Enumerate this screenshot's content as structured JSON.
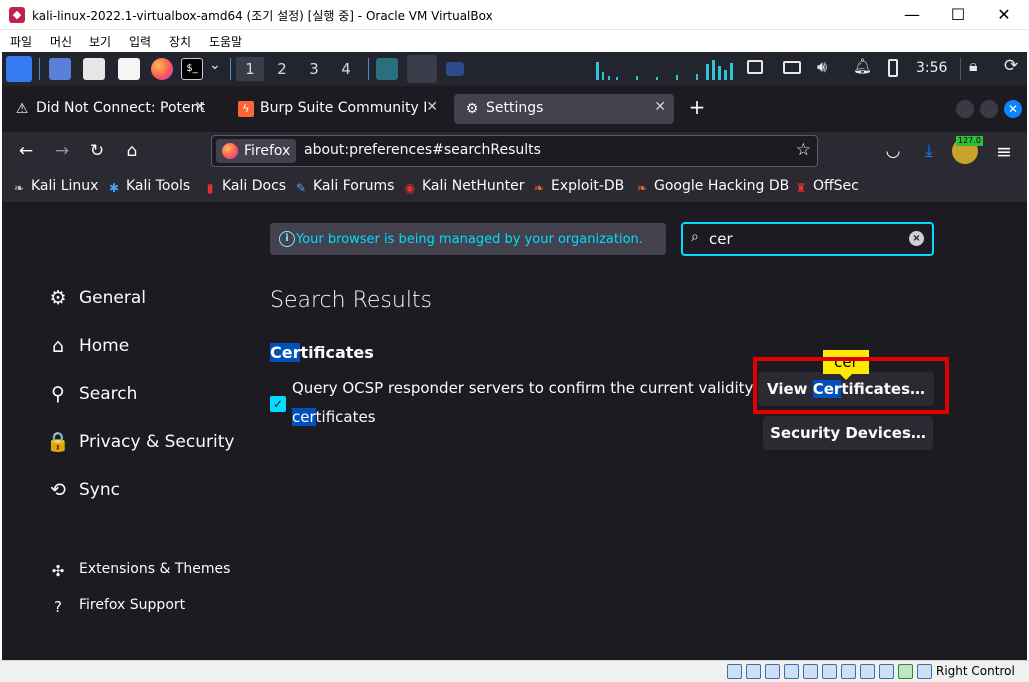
{
  "host_window": {
    "title": "kali-linux-2022.1-virtualbox-amd64 (조기 설정) [실행 중] - Oracle VM VirtualBox",
    "minimize_glyph": "—",
    "maximize_glyph": "☐",
    "close_glyph": "✕",
    "menu": [
      "파일",
      "머신",
      "보기",
      "입력",
      "장치",
      "도움말"
    ],
    "host_key_label": "Right Control"
  },
  "kali_panel": {
    "workspaces": [
      "1",
      "2",
      "3",
      "4"
    ],
    "active_workspace": "1",
    "clock": "3:56",
    "terminal_glyph": "$_",
    "chevron": "⌄"
  },
  "firefox": {
    "tabs": [
      {
        "label": "Did Not Connect: Potential Security Issue",
        "icon": "warning-icon",
        "glyph": "⚠",
        "close": "✕"
      },
      {
        "label": "Burp Suite Community Edition",
        "icon": "burp-icon",
        "glyph": "ϟ",
        "close": "✕"
      },
      {
        "label": "Settings",
        "icon": "gear-icon",
        "glyph": "⚙",
        "close": "✕"
      }
    ],
    "new_tab_glyph": "+",
    "close_window_glyph": "✕",
    "nav": {
      "back": "←",
      "forward": "→",
      "reload": "↻",
      "home": "⌂",
      "star": "☆",
      "pocket": "◡",
      "download": "⤓",
      "menu": "≡"
    },
    "url_chip": "Firefox",
    "url": "about:preferences#searchResults",
    "extension_badge": "127.0",
    "bookmarks": [
      {
        "label": "Kali Linux",
        "icon": "kali-dragon-icon",
        "glyph": "❧"
      },
      {
        "label": "Kali Tools",
        "icon": "kali-tools-icon",
        "glyph": "✱"
      },
      {
        "label": "Kali Docs",
        "icon": "kali-docs-icon",
        "glyph": "▮"
      },
      {
        "label": "Kali Forums",
        "icon": "kali-forums-icon",
        "glyph": "✎"
      },
      {
        "label": "Kali NetHunter",
        "icon": "nethunter-icon",
        "glyph": "◉"
      },
      {
        "label": "Exploit-DB",
        "icon": "exploitdb-icon",
        "glyph": "❧"
      },
      {
        "label": "Google Hacking DB",
        "icon": "ghdb-icon",
        "glyph": "❧"
      },
      {
        "label": "OffSec",
        "icon": "offsec-icon",
        "glyph": "♜"
      }
    ]
  },
  "prefs": {
    "policy_notice": "Your browser is being managed by your organization.",
    "info_glyph": "i",
    "search_glyph": "⌕",
    "clear_glyph": "×",
    "search_value": "cer",
    "categories": [
      {
        "label": "General",
        "icon": "gear-icon",
        "glyph": "⚙"
      },
      {
        "label": "Home",
        "icon": "home-icon",
        "glyph": "⌂"
      },
      {
        "label": "Search",
        "icon": "search-icon",
        "glyph": "⚲"
      },
      {
        "label": "Privacy & Security",
        "icon": "lock-icon",
        "glyph": "🔒"
      },
      {
        "label": "Sync",
        "icon": "sync-icon",
        "glyph": "⟲"
      }
    ],
    "footer_links": [
      {
        "label": "Extensions & Themes",
        "icon": "puzzle-icon",
        "glyph": "✣"
      },
      {
        "label": "Firefox Support",
        "icon": "help-icon",
        "glyph": "?"
      }
    ],
    "results_heading": "Search Results",
    "certs_heading_hl": "Cer",
    "certs_heading_rest": "tificates",
    "checkbox_glyph": "✓",
    "ocsp_line1": "Query OCSP responder servers to confirm the current validity of",
    "ocsp_line2_hl": "cer",
    "ocsp_line2_rest": "tificates",
    "view_btn_pre": "View ",
    "view_btn_hl": "Cer",
    "view_btn_rest": "tificates…",
    "security_devices_btn": "Security Devices…",
    "tooltip": "cer"
  }
}
